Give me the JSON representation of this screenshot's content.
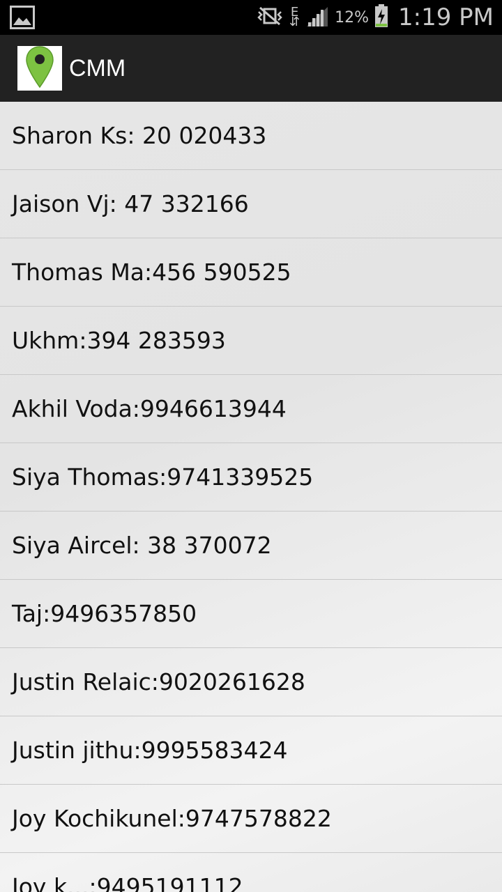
{
  "status_bar": {
    "battery": "12%",
    "network": "E",
    "time": "1:19 PM"
  },
  "action_bar": {
    "title": "CMM",
    "icon": "map-pin-icon"
  },
  "contacts": [
    "Sharon Ks: 20 020433",
    "Jaison Vj: 47 332166",
    "Thomas Ma:456 590525",
    "Ukhm:394 283593",
    "Akhil Voda:9946613944",
    "Siya Thomas:9741339525",
    "Siya Aircel: 38 370072",
    "Taj:9496357850",
    "Justin Relaic:9020261628",
    "Justin jithu:9995583424",
    "Joy Kochikunel:9747578822",
    "Joy k...:9495191112"
  ],
  "colors": {
    "status_bar_bg": "#000000",
    "action_bar_bg": "#222222",
    "list_bg": "#e9e9e9",
    "pin_green": "#7dc242"
  }
}
